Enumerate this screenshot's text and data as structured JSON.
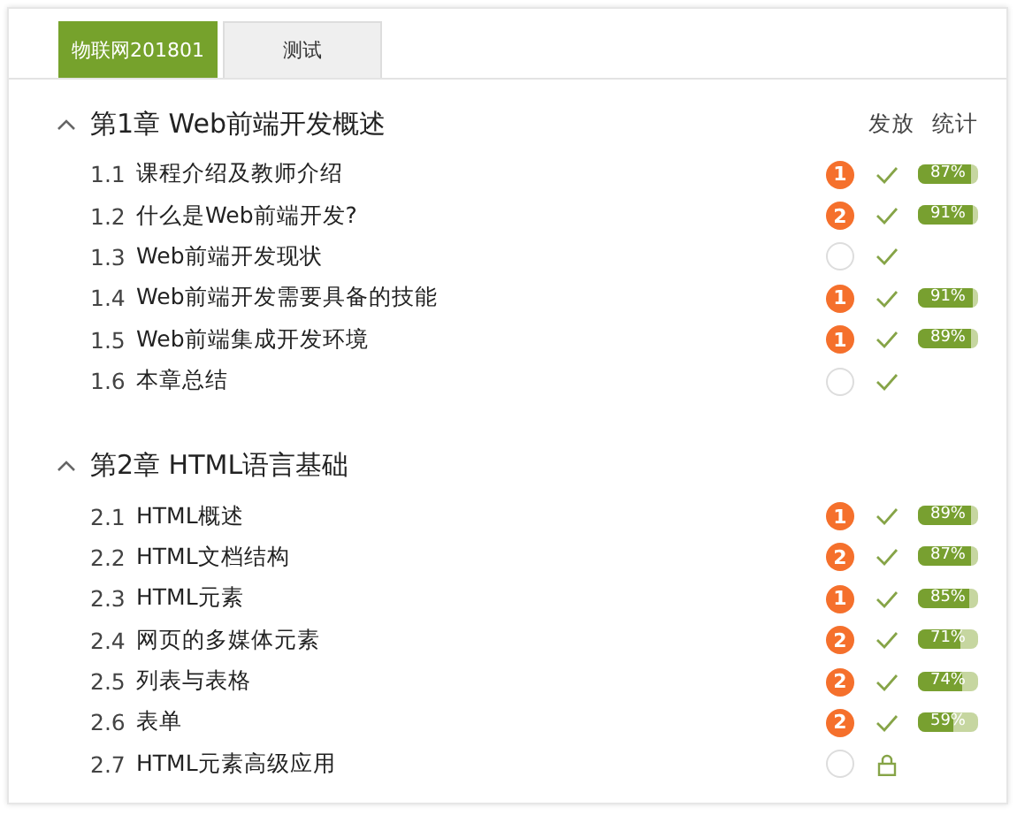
{
  "tabs": [
    {
      "label": "物联网201801",
      "selected": true
    },
    {
      "label": "测试",
      "selected": false
    }
  ],
  "column_headers": [
    "发放",
    "统计"
  ],
  "chapters": [
    {
      "title": "第1章 Web前端开发概述",
      "expanded": true,
      "sections": [
        {
          "kind": "released",
          "number": "1.1",
          "title": "课程介绍及教师介绍",
          "badge": {
            "kind": "count",
            "text": "1"
          },
          "progress": {
            "level": 0.87,
            "text": "87%"
          }
        },
        {
          "kind": "released",
          "number": "1.2",
          "title": "什么是Web前端开发?",
          "badge": {
            "kind": "count",
            "text": "2"
          },
          "progress": {
            "level": 0.91,
            "text": "91%"
          }
        },
        {
          "kind": "released",
          "number": "1.3",
          "title": "Web前端开发现状",
          "badge": {
            "kind": "empty"
          }
        },
        {
          "kind": "released",
          "number": "1.4",
          "title": "Web前端开发需要具备的技能",
          "badge": {
            "kind": "count",
            "text": "1"
          },
          "progress": {
            "level": 0.91,
            "text": "91%"
          }
        },
        {
          "kind": "released",
          "number": "1.5",
          "title": "Web前端集成开发环境",
          "badge": {
            "kind": "count",
            "text": "1"
          },
          "progress": {
            "level": 0.89,
            "text": "89%"
          }
        },
        {
          "kind": "released",
          "number": "1.6",
          "title": "本章总结",
          "badge": {
            "kind": "empty"
          }
        }
      ]
    },
    {
      "title": "第2章 HTML语言基础",
      "expanded": true,
      "sections": [
        {
          "kind": "released",
          "number": "2.1",
          "title": "HTML概述",
          "badge": {
            "kind": "count",
            "text": "1"
          },
          "progress": {
            "level": 0.89,
            "text": "89%"
          }
        },
        {
          "kind": "released",
          "number": "2.2",
          "title": "HTML文档结构",
          "badge": {
            "kind": "count",
            "text": "2"
          },
          "progress": {
            "level": 0.87,
            "text": "87%"
          }
        },
        {
          "kind": "released",
          "number": "2.3",
          "title": "HTML元素",
          "badge": {
            "kind": "count",
            "text": "1"
          },
          "progress": {
            "level": 0.85,
            "text": "85%"
          }
        },
        {
          "kind": "released",
          "number": "2.4",
          "title": "网页的多媒体元素",
          "badge": {
            "kind": "count",
            "text": "2"
          },
          "progress": {
            "level": 0.71,
            "text": "71%"
          }
        },
        {
          "kind": "released",
          "number": "2.5",
          "title": "列表与表格",
          "badge": {
            "kind": "count",
            "text": "2"
          },
          "progress": {
            "level": 0.74,
            "text": "74%"
          }
        },
        {
          "kind": "released",
          "number": "2.6",
          "title": "表单",
          "badge": {
            "kind": "count",
            "text": "2"
          },
          "progress": {
            "level": 0.59,
            "text": "59%"
          }
        },
        {
          "kind": "locked",
          "number": "2.7",
          "title": "HTML元素高级应用",
          "badge": {
            "kind": "empty"
          }
        }
      ]
    }
  ]
}
